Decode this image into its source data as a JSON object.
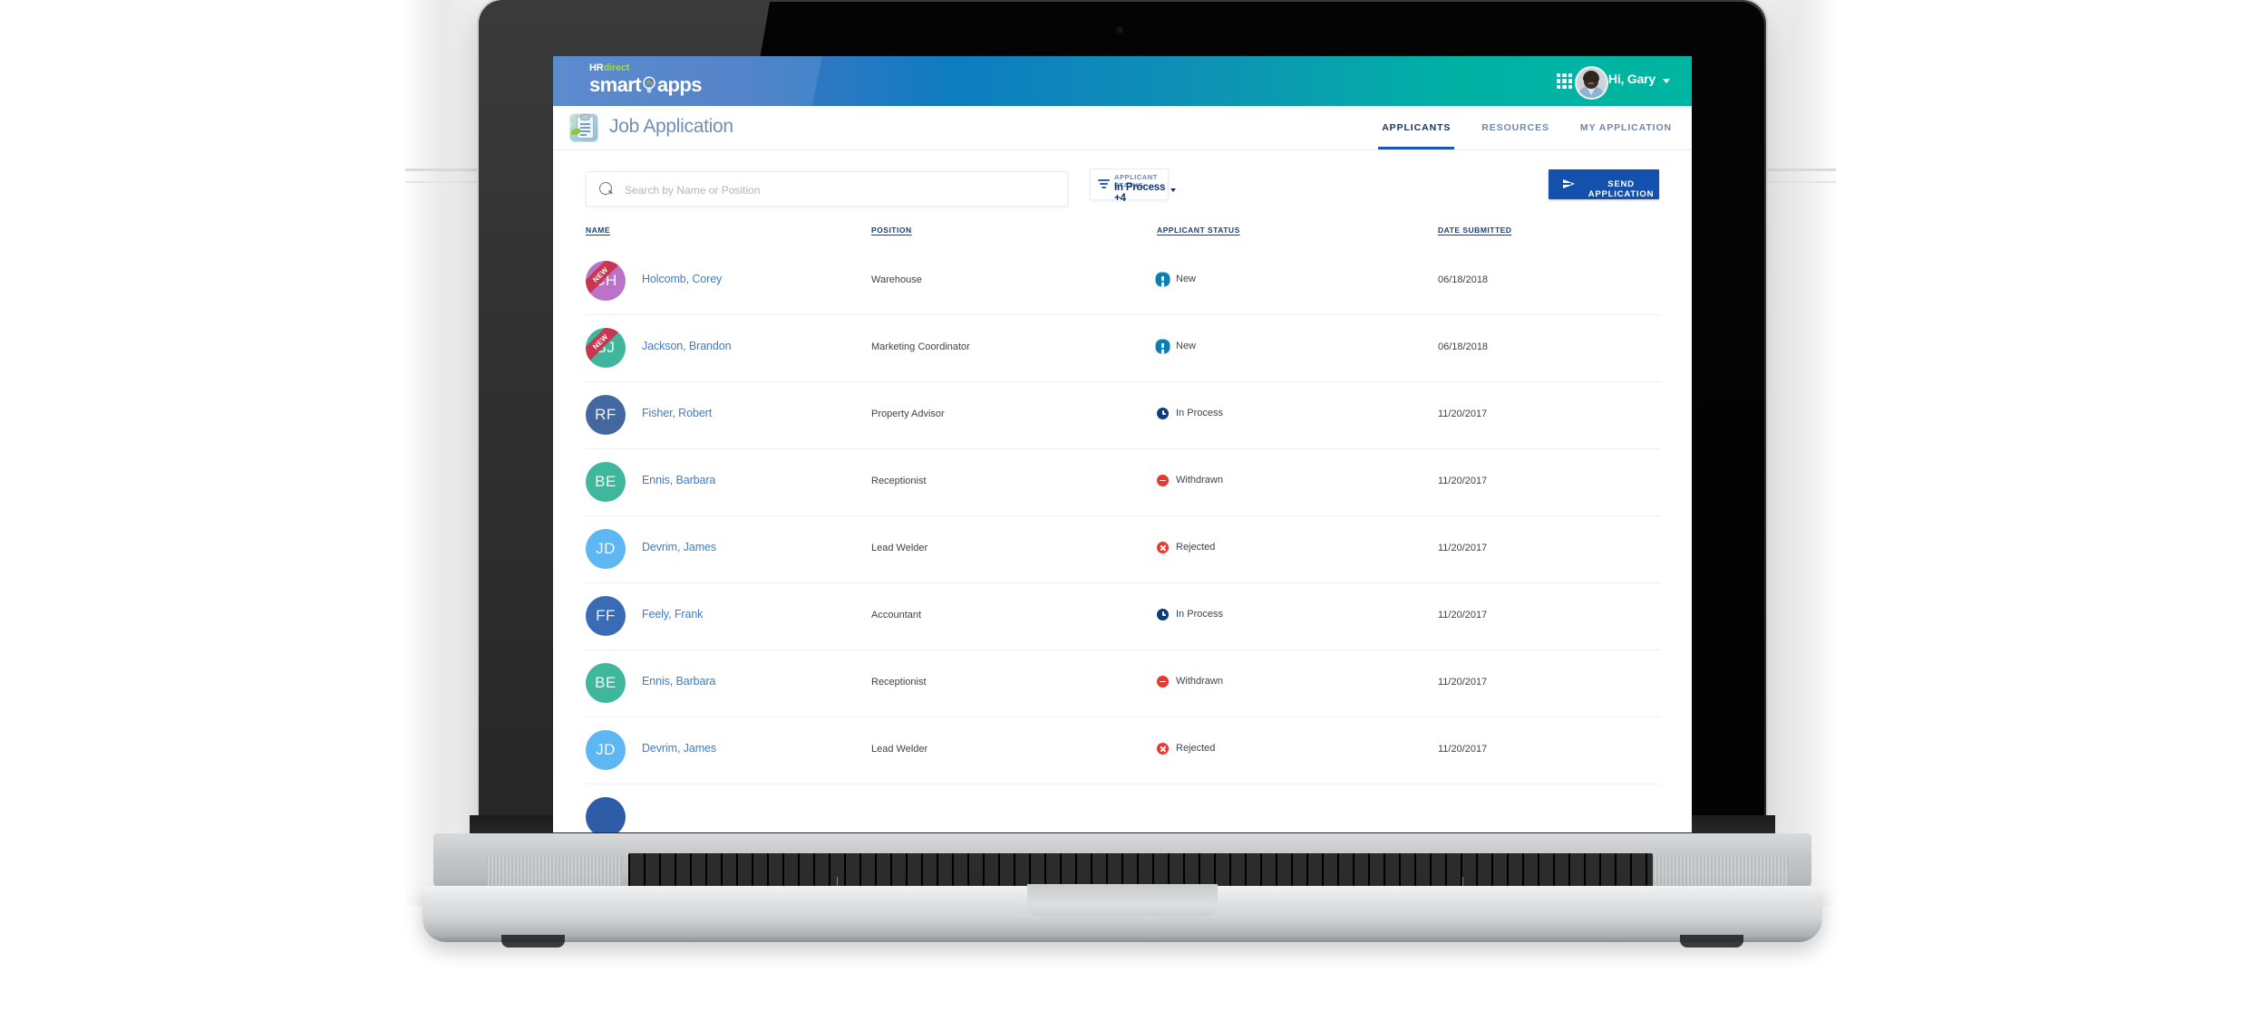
{
  "topbar": {
    "brand_hr": "HR",
    "brand_direct": "direct",
    "brand_smart": "smart",
    "brand_apps": "apps",
    "apps_grid_icon": "grid-apps-icon",
    "greeting": "Hi, Gary",
    "avatar_icon": "user-photo-avatar",
    "caret_icon": "chevron-down-icon"
  },
  "subheader": {
    "app_icon": "job-application-clipboard-icon",
    "title": "Job Application",
    "tabs": [
      {
        "label": "APPLICANTS",
        "active": true
      },
      {
        "label": "RESOURCES",
        "active": false
      },
      {
        "label": "MY APPLICATION",
        "active": false
      }
    ]
  },
  "toolbar": {
    "search_placeholder": "Search by Name or Position",
    "search_value": "",
    "search_icon": "search-icon",
    "filter_icon": "filter-funnel-icon",
    "filter_label": "APPLICANT STATUS",
    "filter_value": "In Process +4",
    "filter_caret_icon": "caret-down-icon",
    "send_icon": "send-paper-plane-icon",
    "send_label": "SEND APPLICATION"
  },
  "table": {
    "columns": [
      {
        "key": "name",
        "label": "NAME"
      },
      {
        "key": "position",
        "label": "POSITION"
      },
      {
        "key": "status",
        "label": "APPLICANT STATUS"
      },
      {
        "key": "date",
        "label": "DATE SUBMITTED"
      }
    ],
    "rows": [
      {
        "initials": "CH",
        "avatar_color": "#bb72c9",
        "badge": "NEW",
        "name": "Holcomb, Corey",
        "position": "Warehouse",
        "status": "New",
        "status_icon": "new-icon",
        "date": "06/18/2018"
      },
      {
        "initials": "BJ",
        "avatar_color": "#3fb79c",
        "badge": "NEW",
        "name": "Jackson, Brandon",
        "position": "Marketing Coordinator",
        "status": "New",
        "status_icon": "new-icon",
        "date": "06/18/2018"
      },
      {
        "initials": "RF",
        "avatar_color": "#42689f",
        "badge": "",
        "name": "Fisher, Robert",
        "position": "Property Advisor",
        "status": "In Process",
        "status_icon": "clock-icon",
        "date": "11/20/2017"
      },
      {
        "initials": "BE",
        "avatar_color": "#3fb79c",
        "badge": "",
        "name": "Ennis, Barbara",
        "position": "Receptionist",
        "status": "Withdrawn",
        "status_icon": "minus-circle-icon",
        "date": "11/20/2017"
      },
      {
        "initials": "JD",
        "avatar_color": "#5cb7f2",
        "badge": "",
        "name": "Devrim, James",
        "position": "Lead Welder",
        "status": "Rejected",
        "status_icon": "x-circle-icon",
        "date": "11/20/2017"
      },
      {
        "initials": "FF",
        "avatar_color": "#3a6bb5",
        "badge": "",
        "name": "Feely, Frank",
        "position": "Accountant",
        "status": "In Process",
        "status_icon": "clock-icon",
        "date": "11/20/2017"
      },
      {
        "initials": "BE",
        "avatar_color": "#3fb79c",
        "badge": "",
        "name": "Ennis, Barbara",
        "position": "Receptionist",
        "status": "Withdrawn",
        "status_icon": "minus-circle-icon",
        "date": "11/20/2017"
      },
      {
        "initials": "JD",
        "avatar_color": "#5cb7f2",
        "badge": "",
        "name": "Devrim, James",
        "position": "Lead Welder",
        "status": "Rejected",
        "status_icon": "x-circle-icon",
        "date": "11/20/2017"
      },
      {
        "initials": "",
        "avatar_color": "#2f5ca6",
        "badge": "",
        "name": "",
        "position": "",
        "status": "",
        "status_icon": "",
        "date": ""
      }
    ]
  },
  "colors": {
    "header_gradient_start": "#4a7fc9",
    "header_gradient_mid": "#0d7cc0",
    "header_gradient_end": "#00b5a2",
    "primary_button": "#1450ad",
    "link": "#3b7ccc",
    "heading_navy": "#14366b",
    "badge_red": "#c8364f",
    "status_new": "#0b7fb5",
    "status_in_process": "#113a7d",
    "status_negative": "#e8392e"
  }
}
